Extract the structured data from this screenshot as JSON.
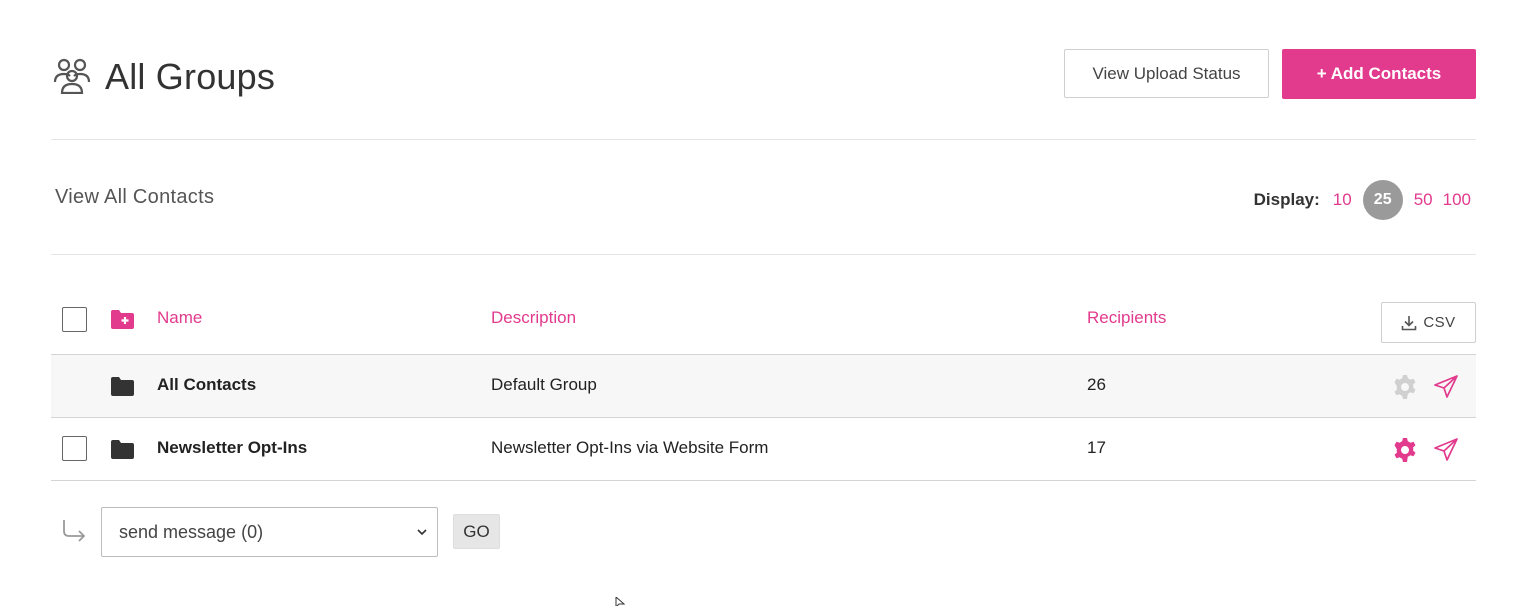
{
  "header": {
    "title": "All Groups",
    "icon": "groups-icon",
    "view_upload_label": "View Upload Status",
    "add_contacts_label": "+ Add Contacts"
  },
  "section": {
    "title": "View All Contacts",
    "display_label": "Display:",
    "display_options": [
      "10",
      "25",
      "50",
      "100"
    ],
    "display_selected": "25"
  },
  "table": {
    "columns": {
      "name": "Name",
      "description": "Description",
      "recipients": "Recipients"
    },
    "csv_label": "CSV",
    "rows": [
      {
        "name": "All Contacts",
        "description": "Default Group",
        "recipients": "26",
        "selectable": false,
        "gear_active": false
      },
      {
        "name": "Newsletter Opt-Ins",
        "description": "Newsletter Opt-Ins via Website Form",
        "recipients": "17",
        "selectable": true,
        "gear_active": true
      }
    ]
  },
  "bulk_action": {
    "selected": "send message (0)",
    "go_label": "GO"
  },
  "colors": {
    "accent": "#e23a8d",
    "muted_gear": "#d0d0d0",
    "display_active_bg": "#9a9a9a"
  }
}
